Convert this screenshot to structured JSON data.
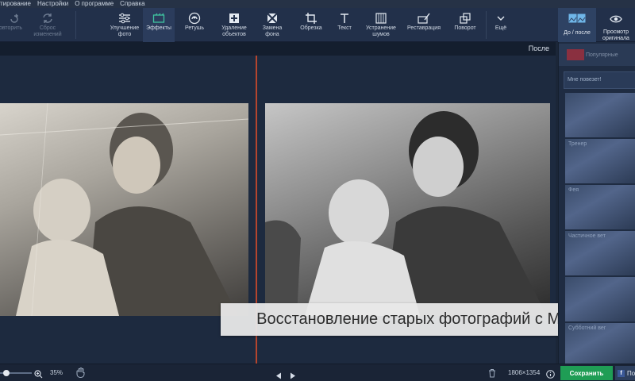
{
  "menu": [
    "тирование",
    "Настройки",
    "О программе",
    "Справка"
  ],
  "toolbar": {
    "undo": "Повторить",
    "reset": "Сброс изменений",
    "tools": [
      {
        "label": "Улучшение фото",
        "icon": "sliders-icon"
      },
      {
        "label": "Эффекты",
        "icon": "effects-icon"
      },
      {
        "label": "Ретушь",
        "icon": "retouch-icon"
      },
      {
        "label": "Удаление объектов",
        "icon": "object-removal-icon"
      },
      {
        "label": "Замена фона",
        "icon": "background-replace-icon"
      },
      {
        "label": "Обрезка",
        "icon": "crop-icon"
      },
      {
        "label": "Текст",
        "icon": "text-icon"
      },
      {
        "label": "Устранение шумов",
        "icon": "denoise-icon"
      },
      {
        "label": "Реставрация",
        "icon": "restoration-icon"
      },
      {
        "label": "Поворот",
        "icon": "rotate-icon"
      },
      {
        "label": "Ещё",
        "icon": "chevron-down-icon"
      }
    ],
    "before_after": "До / после",
    "preview_original": "Просмотр оригинала"
  },
  "canvas": {
    "after_label": "После",
    "banner": "Восстановление старых фотографий с Movavi"
  },
  "right_panel": {
    "category": "Популярные",
    "search_placeholder": "Мне повезет!",
    "thumbs": [
      {
        "label": ""
      },
      {
        "label": "Тренер"
      },
      {
        "label": "Фея"
      },
      {
        "label": "Частичное вет"
      },
      {
        "label": ""
      },
      {
        "label": "Субботний вег"
      }
    ]
  },
  "status": {
    "zoom": "35%",
    "dimensions": "1806×1354",
    "save": "Сохранить",
    "share": "По"
  },
  "colors": {
    "accent_green": "#1f9d55",
    "divider_red": "#b5452e",
    "toolbar_bg": "#22304a"
  }
}
